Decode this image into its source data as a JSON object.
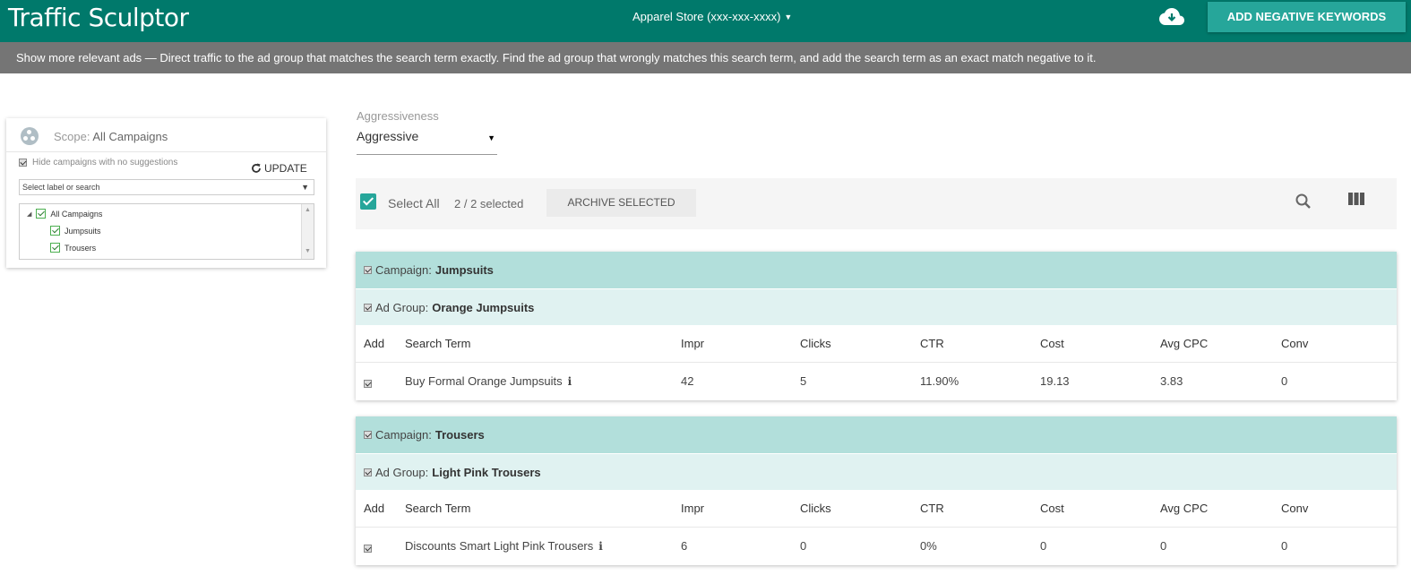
{
  "header": {
    "title": "Traffic Sculptor",
    "account": "Apparel Store (xxx-xxx-xxxx)",
    "add_negative_label": "ADD NEGATIVE KEYWORDS"
  },
  "info_text": "Show more relevant ads — Direct traffic to the ad group that matches the search term exactly. Find the ad group that wrongly matches this search term, and add the search term as an exact match negative to it.",
  "scope": {
    "label": "Scope:",
    "value": "All Campaigns",
    "hide_label": "Hide campaigns with no suggestions",
    "update_label": "UPDATE",
    "select_placeholder": "Select label or search",
    "tree": [
      "All Campaigns",
      "Jumpsuits",
      "Trousers"
    ]
  },
  "aggressiveness": {
    "label": "Aggressiveness",
    "value": "Aggressive"
  },
  "toolbar": {
    "select_all": "Select All",
    "count": "2 / 2 selected",
    "archive_label": "ARCHIVE SELECTED"
  },
  "columns": [
    "Add",
    "Search Term",
    "Impr",
    "Clicks",
    "CTR",
    "Cost",
    "Avg CPC",
    "Conv"
  ],
  "groups": [
    {
      "campaign_label": "Campaign:",
      "campaign": "Jumpsuits",
      "adgroup_label": "Ad Group:",
      "adgroup": "Orange Jumpsuits",
      "row": {
        "term": "Buy Formal Orange Jumpsuits",
        "impr": "42",
        "clicks": "5",
        "ctr": "11.90%",
        "cost": "19.13",
        "avg_cpc": "3.83",
        "conv": "0"
      }
    },
    {
      "campaign_label": "Campaign:",
      "campaign": "Trousers",
      "adgroup_label": "Ad Group:",
      "adgroup": "Light Pink Trousers",
      "row": {
        "term": "Discounts Smart Light Pink Trousers",
        "impr": "6",
        "clicks": "0",
        "ctr": "0%",
        "cost": "0",
        "avg_cpc": "0",
        "conv": "0"
      }
    }
  ],
  "icons": {
    "download": "cloud-download-icon",
    "search": "search-icon",
    "columns": "columns-icon",
    "info": "info-icon"
  },
  "colors": {
    "primary": "#00796b",
    "accent": "#26a69a",
    "info_bar": "#757575",
    "campaign_row": "#b2dfdb",
    "adgroup_row": "#e0f2f1"
  }
}
